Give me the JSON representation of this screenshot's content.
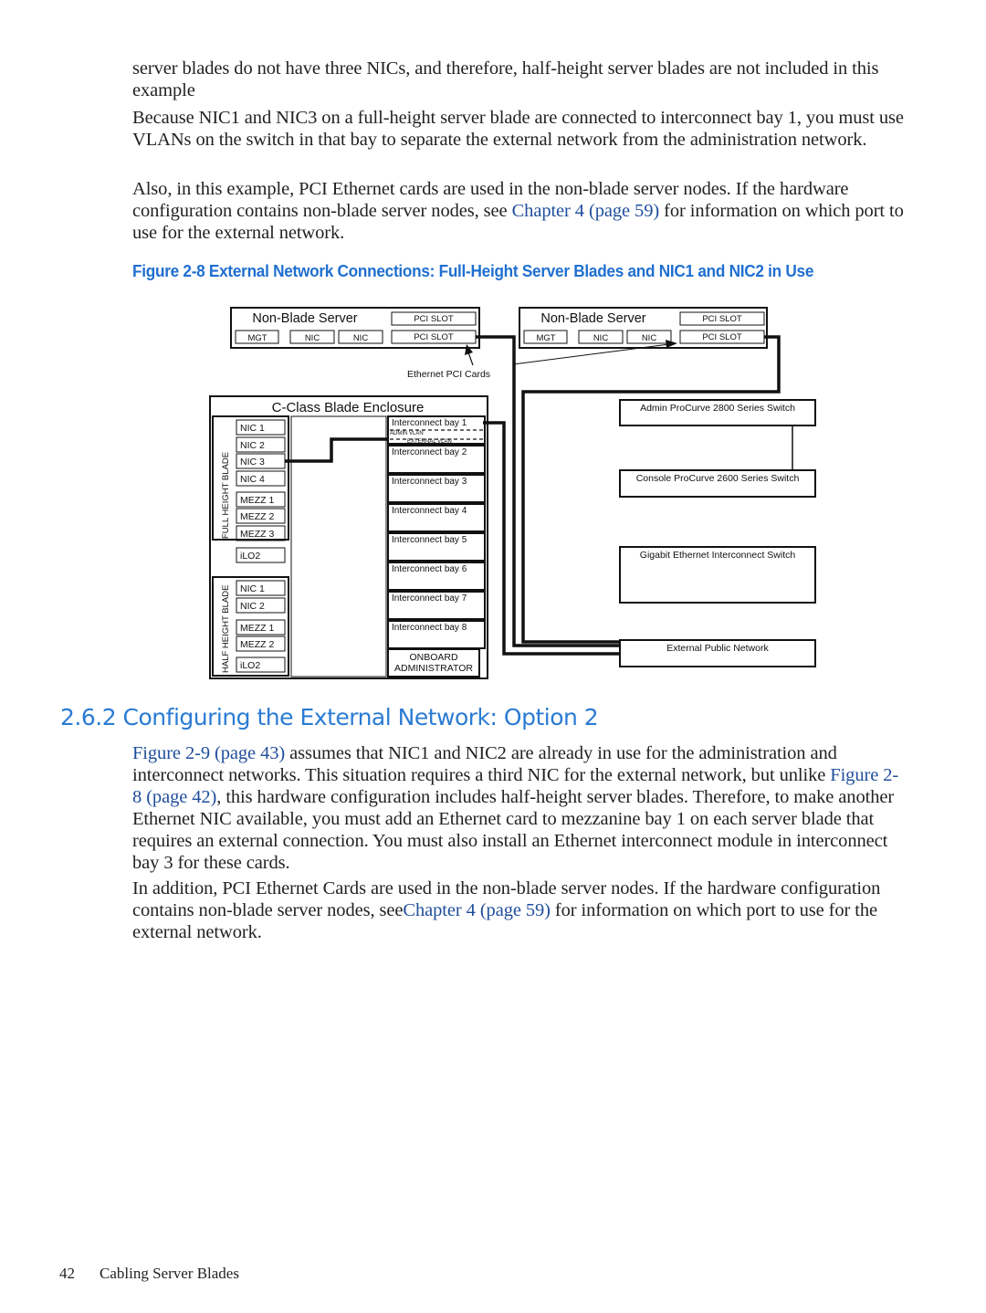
{
  "paragraphs_top": [
    {
      "text": "server blades do not have three NICs, and therefore, half-height server blades are not included in this example"
    },
    {
      "text": "Because NIC1 and NIC3 on a full-height server blade are connected to interconnect bay 1, you must use VLANs on the switch in that bay to separate the external network from the administration network."
    },
    {
      "pre": "Also, in this example, PCI Ethernet cards are used in the non-blade server nodes. If the hardware configuration contains non-blade server nodes, see ",
      "link1": "Chapter 4",
      "mid": " ",
      "link2": "(page 59)",
      "post": " for information on which port to use for the external network."
    }
  ],
  "figure_caption": "Figure 2-8 External Network Connections: Full-Height Server Blades and NIC1 and NIC2 in Use",
  "diagram": {
    "non_blade_server": {
      "title": "Non-Blade Server",
      "pci_slot": "PCI SLOT",
      "mgt": "MGT",
      "nic": "NIC"
    },
    "ethernet_pci_cards": "Ethernet PCI Cards",
    "enclosure_title": "C-Class Blade Enclosure",
    "full_height_label": "FULL HEIGHT BLADE",
    "half_height_label": "HALF HEIGHT BLADE",
    "full_height_ports": [
      "NIC 1",
      "NIC 2",
      "NIC 3",
      "NIC 4",
      "MEZZ 1",
      "MEZZ 2",
      "MEZZ 3",
      "iLO2"
    ],
    "half_height_ports": [
      "NIC 1",
      "NIC 2",
      "MEZZ 1",
      "MEZZ 2",
      "iLO2"
    ],
    "interconnect_bays": [
      "Interconnect bay 1",
      "Interconnect bay 2",
      "Interconnect bay 3",
      "Interconnect bay 4",
      "Interconnect bay 5",
      "Interconnect bay 6",
      "Interconnect bay 7",
      "Interconnect bay 8"
    ],
    "admin_vlan": "ADMIN VLAN",
    "external_vlan": "EXTERNAL VLAN",
    "onboard_admin": [
      "ONBOARD",
      "ADMINISTRATOR"
    ],
    "switches": [
      "Admin ProCurve 2800 Series Switch",
      "Console ProCurve 2600 Series Switch",
      "Gigabit Ethernet Interconnect Switch",
      "External Public Network"
    ]
  },
  "section_heading": "2.6.2 Configuring the External Network: Option 2",
  "paragraphs_bottom": [
    {
      "link1": "Figure 2-9",
      "link2": "(page 43)",
      "text1": " assumes that NIC1 and NIC2 are already in use for the administration and interconnect networks. This situation requires a third NIC for the external network, but unlike ",
      "link3": "Figure 2-8",
      "link4": "(page 42)",
      "text2": ", this hardware configuration includes half-height server blades. Therefore, to make another Ethernet NIC available, you must add an Ethernet card to mezzanine bay 1 on each server blade that requires an external connection. You must also install an Ethernet interconnect module in interconnect bay 3 for these cards."
    },
    {
      "pre": "In addition, PCI Ethernet Cards are used in the non-blade server nodes. If the hardware configuration contains non-blade server nodes, see",
      "link1": "Chapter 4",
      "link2": "(page 59)",
      "post": " for information on which port to use for the external network."
    }
  ],
  "footer": {
    "page_number": "42",
    "chapter": "Cabling Server Blades"
  },
  "colors": {
    "link": "#1f4e9c",
    "heading": "#2a7bd4",
    "caption": "#1f6fd0"
  }
}
